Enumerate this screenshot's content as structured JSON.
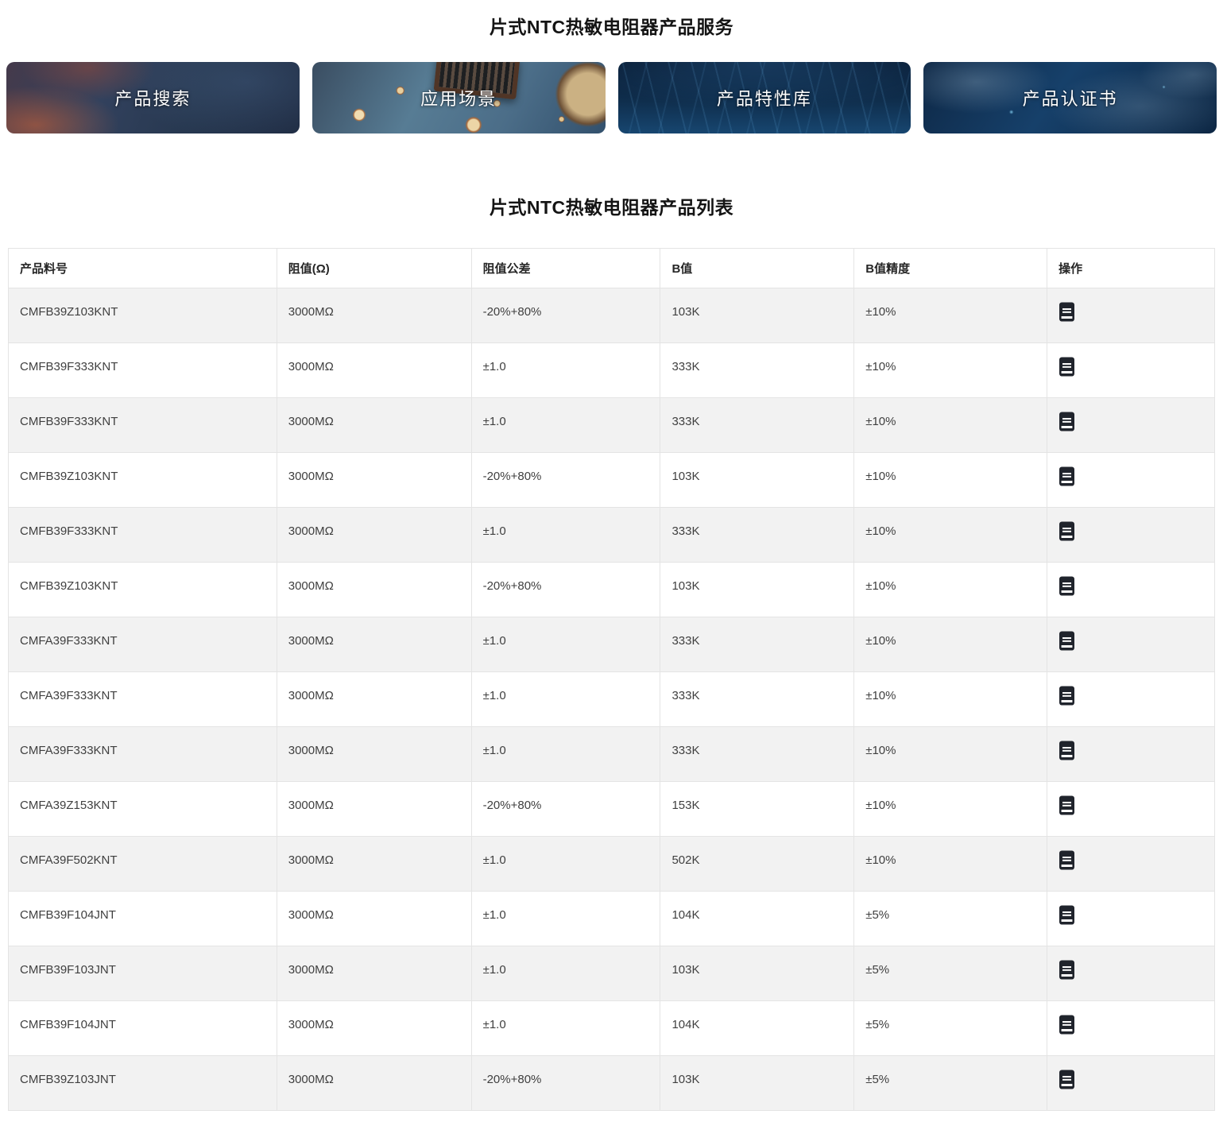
{
  "page": {
    "service_title": "片式NTC热敏电阻器产品服务",
    "list_title": "片式NTC热敏电阻器产品列表"
  },
  "banners": [
    {
      "id": "product-search",
      "label": "产品搜索"
    },
    {
      "id": "app-scenarios",
      "label": "应用场景"
    },
    {
      "id": "feature-library",
      "label": "产品特性库"
    },
    {
      "id": "certificates",
      "label": "产品认证书"
    }
  ],
  "table": {
    "columns": [
      "产品料号",
      "阻值(Ω)",
      "阻值公差",
      "B值",
      "B值精度",
      "操作"
    ],
    "action_icon": "document-icon",
    "rows": [
      {
        "part_number": "CMFB39Z103KNT",
        "resistance": "3000MΩ",
        "tolerance": "-20%+80%",
        "b_value": "103K",
        "b_precision": "±10%"
      },
      {
        "part_number": "CMFB39F333KNT",
        "resistance": "3000MΩ",
        "tolerance": "±1.0",
        "b_value": "333K",
        "b_precision": "±10%"
      },
      {
        "part_number": "CMFB39F333KNT",
        "resistance": "3000MΩ",
        "tolerance": "±1.0",
        "b_value": "333K",
        "b_precision": "±10%"
      },
      {
        "part_number": "CMFB39Z103KNT",
        "resistance": "3000MΩ",
        "tolerance": "-20%+80%",
        "b_value": "103K",
        "b_precision": "±10%"
      },
      {
        "part_number": "CMFB39F333KNT",
        "resistance": "3000MΩ",
        "tolerance": "±1.0",
        "b_value": "333K",
        "b_precision": "±10%"
      },
      {
        "part_number": "CMFB39Z103KNT",
        "resistance": "3000MΩ",
        "tolerance": "-20%+80%",
        "b_value": "103K",
        "b_precision": "±10%"
      },
      {
        "part_number": "CMFA39F333KNT",
        "resistance": "3000MΩ",
        "tolerance": "±1.0",
        "b_value": "333K",
        "b_precision": "±10%"
      },
      {
        "part_number": "CMFA39F333KNT",
        "resistance": "3000MΩ",
        "tolerance": "±1.0",
        "b_value": "333K",
        "b_precision": "±10%"
      },
      {
        "part_number": "CMFA39F333KNT",
        "resistance": "3000MΩ",
        "tolerance": "±1.0",
        "b_value": "333K",
        "b_precision": "±10%"
      },
      {
        "part_number": "CMFA39Z153KNT",
        "resistance": "3000MΩ",
        "tolerance": "-20%+80%",
        "b_value": "153K",
        "b_precision": "±10%"
      },
      {
        "part_number": "CMFA39F502KNT",
        "resistance": "3000MΩ",
        "tolerance": "±1.0",
        "b_value": "502K",
        "b_precision": "±10%"
      },
      {
        "part_number": "CMFB39F104JNT",
        "resistance": "3000MΩ",
        "tolerance": "±1.0",
        "b_value": "104K",
        "b_precision": "±5%"
      },
      {
        "part_number": "CMFB39F103JNT",
        "resistance": "3000MΩ",
        "tolerance": "±1.0",
        "b_value": "103K",
        "b_precision": "±5%"
      },
      {
        "part_number": "CMFB39F104JNT",
        "resistance": "3000MΩ",
        "tolerance": "±1.0",
        "b_value": "104K",
        "b_precision": "±5%"
      },
      {
        "part_number": "CMFB39Z103JNT",
        "resistance": "3000MΩ",
        "tolerance": "-20%+80%",
        "b_value": "103K",
        "b_precision": "±5%"
      }
    ]
  },
  "colors": {
    "stripe": "#f2f2f2",
    "border": "#e4e4e4",
    "title_text": "#141414",
    "cell_text": "#3f3f3f"
  }
}
